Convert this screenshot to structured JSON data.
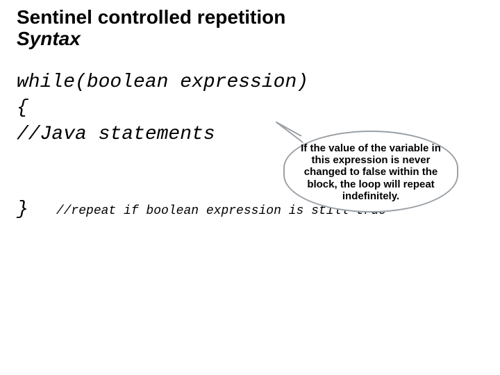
{
  "title": {
    "line1": "Sentinel controlled  repetition",
    "line2": "Syntax"
  },
  "code": {
    "line_while": "while(boolean expression)",
    "line_open": "{",
    "line_comment": "//Java statements",
    "line_close": "}",
    "line_repeat": "//repeat if boolean expression is still true"
  },
  "callout": {
    "text": "If the value of the variable in this expression is never changed to false within the block, the loop will repeat indefinitely."
  }
}
